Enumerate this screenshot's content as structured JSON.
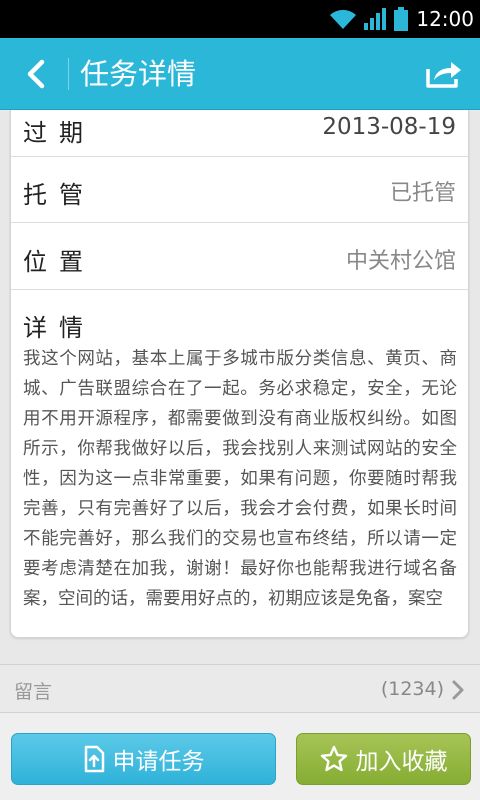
{
  "status_bar": {
    "time": "12:00",
    "icons": [
      "wifi-icon",
      "signal-icon",
      "battery-icon"
    ]
  },
  "header": {
    "title": "任务详情",
    "back_icon": "back-arrow-icon",
    "share_icon": "share-icon"
  },
  "details": {
    "expire": {
      "label": "过期",
      "value": "2013-08-19"
    },
    "trust": {
      "label": "托管",
      "value": "已托管"
    },
    "location": {
      "label": "位置",
      "value": "中关村公馆"
    },
    "description": {
      "label": "详情",
      "text": "我这个网站，基本上属于多城市版分类信息、黄页、商城、广告联盟综合在了一起。务必求稳定，安全，无论用不用开源程序，都需要做到没有商业版权纠纷。如图所示，你帮我做好以后，我会找别人来测试网站的安全性，因为这一点非常重要，如果有问题，你要随时帮我完善，只有完善好了以后，我会才会付费，如果长时间不能完善好，那么我们的交易也宣布终结，所以请一定要考虑清楚在加我，谢谢！最好你也能帮我进行域名备案，空间的话，需要用好点的，初期应该是免备，案空"
    }
  },
  "comments": {
    "label": "留言",
    "count": "(1234)"
  },
  "actions": {
    "apply_label": "申请任务",
    "favorite_label": "加入收藏"
  },
  "colors": {
    "header_bg": "#2bb7d8",
    "apply_button": "#3dbbdf",
    "favorite_button": "#92b53f"
  }
}
